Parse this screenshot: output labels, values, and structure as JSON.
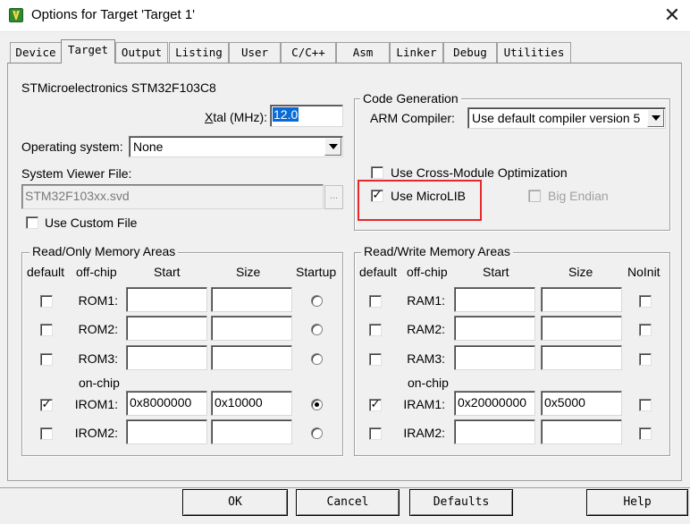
{
  "window": {
    "title": "Options for Target 'Target 1'",
    "close_glyph": "✕"
  },
  "tabs": [
    {
      "label": "Device",
      "active": false
    },
    {
      "label": "Target",
      "active": true
    },
    {
      "label": "Output",
      "active": false
    },
    {
      "label": "Listing",
      "active": false
    },
    {
      "label": "User",
      "active": false
    },
    {
      "label": "C/C++",
      "active": false
    },
    {
      "label": "Asm",
      "active": false
    },
    {
      "label": "Linker",
      "active": false
    },
    {
      "label": "Debug",
      "active": false
    },
    {
      "label": "Utilities",
      "active": false
    }
  ],
  "device": {
    "name": "STMicroelectronics STM32F103C8"
  },
  "xtal": {
    "label_prefix": "X",
    "label_rest": "tal (MHz):",
    "value": "12.0"
  },
  "os": {
    "label": "Operating system:",
    "value": "None"
  },
  "svd": {
    "label": "System Viewer File:",
    "value": "STM32F103xx.svd",
    "browse": "..."
  },
  "custom_file": {
    "label": "Use Custom File",
    "checked": false
  },
  "codegen": {
    "title": "Code Generation",
    "compiler_label": "ARM Compiler:",
    "compiler_value": "Use default compiler version 5",
    "cross_module": {
      "label": "Use Cross-Module Optimization",
      "checked": false
    },
    "microlib": {
      "label": "Use MicroLIB",
      "checked": true,
      "check_glyph": "✓"
    },
    "big_endian": {
      "label_prefix": "Big",
      "label_rest": " Endian",
      "checked": false
    }
  },
  "rom": {
    "title": "Read/Only Memory Areas",
    "headers": {
      "default": "default",
      "offchip": "off-chip",
      "start": "Start",
      "size": "Size",
      "startup": "Startup"
    },
    "onchip_label": "on-chip",
    "rows": [
      {
        "label": "ROM1:",
        "default": false,
        "start": "",
        "size": "",
        "startup": false
      },
      {
        "label": "ROM2:",
        "default": false,
        "start": "",
        "size": "",
        "startup": false
      },
      {
        "label": "ROM3:",
        "default": false,
        "start": "",
        "size": "",
        "startup": false
      },
      {
        "label": "IROM1:",
        "default": true,
        "start": "0x8000000",
        "size": "0x10000",
        "startup": true
      },
      {
        "label": "IROM2:",
        "default": false,
        "start": "",
        "size": "",
        "startup": false
      }
    ]
  },
  "ram": {
    "title": "Read/Write Memory Areas",
    "headers": {
      "default": "default",
      "offchip": "off-chip",
      "start": "Start",
      "size": "Size",
      "noinit": "NoInit"
    },
    "onchip_label": "on-chip",
    "rows": [
      {
        "label": "RAM1:",
        "default": false,
        "start": "",
        "size": "",
        "noinit": false
      },
      {
        "label": "RAM2:",
        "default": false,
        "start": "",
        "size": "",
        "noinit": false
      },
      {
        "label": "RAM3:",
        "default": false,
        "start": "",
        "size": "",
        "noinit": false
      },
      {
        "label": "IRAM1:",
        "default": true,
        "start": "0x20000000",
        "size": "0x5000",
        "noinit": false
      },
      {
        "label": "IRAM2:",
        "default": false,
        "start": "",
        "size": "",
        "noinit": false
      }
    ]
  },
  "buttons": {
    "ok": "OK",
    "cancel": "Cancel",
    "defaults": "Defaults",
    "help": "Help"
  },
  "check_glyph": "✓",
  "colors": {
    "highlight_box": "#e8272a",
    "selection": "#0a6ad6"
  }
}
